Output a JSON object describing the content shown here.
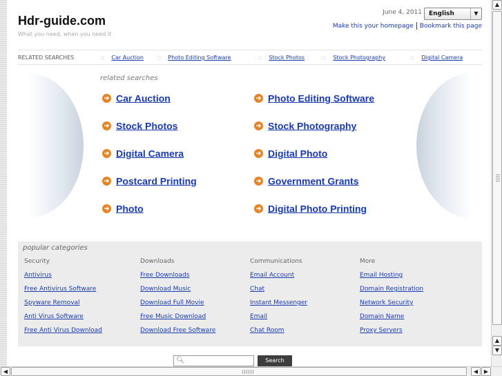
{
  "header": {
    "site_title": "Hdr-guide.com",
    "tagline": "What you need, when you need it",
    "date": "June 4, 2011",
    "language": "English",
    "make_homepage": "Make this your homepage",
    "bookmark": "Bookmark this page"
  },
  "related_bar": {
    "label": "RELATED SEARCHES",
    "separator": "::",
    "items": [
      "Car Auction",
      "Photo Editing Software",
      "Stock Photos",
      "Stock Photography",
      "Digital Camera"
    ]
  },
  "related": {
    "heading": "related searches",
    "items": [
      "Car Auction",
      "Photo Editing Software",
      "Stock Photos",
      "Stock Photography",
      "Digital Camera",
      "Digital Photo",
      "Postcard Printing",
      "Government Grants",
      "Photo",
      "Digital Photo Printing"
    ]
  },
  "popular": {
    "heading": "popular categories",
    "columns": [
      {
        "title": "Security",
        "links": [
          "Antivirus",
          "Free Antivirus Software",
          "Spyware Removal",
          "Anti Virus Software",
          "Free Anti Virus Download"
        ]
      },
      {
        "title": "Downloads",
        "links": [
          "Free Downloads",
          "Download Music",
          "Download Full Movie",
          "Free Music Download",
          "Download Free Software"
        ]
      },
      {
        "title": "Communications",
        "links": [
          "Email Account",
          "Chat",
          "Instant Messenger",
          "Email",
          "Chat Room"
        ]
      },
      {
        "title": "More",
        "links": [
          "Email Hosting",
          "Domain Registration",
          "Network Security",
          "Domain Name",
          "Proxy Servers"
        ]
      }
    ]
  },
  "search": {
    "button_label": "Search",
    "value": ""
  },
  "icons": {
    "bullet": "arrow-circle-icon",
    "search": "magnifier-icon"
  },
  "colors": {
    "link": "#1a3bb0",
    "bullet": "#e5852a",
    "panel": "#ececec",
    "button": "#3d3d3d"
  }
}
